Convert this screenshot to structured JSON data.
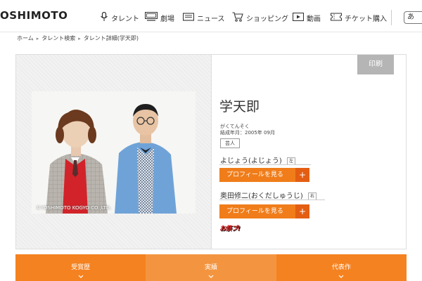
{
  "header": {
    "logo": "OSHIMOTO",
    "nav": [
      {
        "label": "タレント",
        "icon": "microphone-icon"
      },
      {
        "label": "劇場",
        "icon": "theater-icon"
      },
      {
        "label": "ニュース",
        "icon": "news-icon"
      },
      {
        "label": "ショッピング",
        "icon": "cart-icon"
      },
      {
        "label": "動画",
        "icon": "video-icon"
      },
      {
        "label": "チケット購入",
        "icon": "ticket-icon"
      }
    ],
    "lang_label": "あ"
  },
  "breadcrumb": [
    "ホーム",
    "タレント検索",
    "タレント詳細(学天即)"
  ],
  "talent": {
    "photo_copyright": "©YOSHIMOTO KOGYO CO.,LTD.",
    "print_label": "印刷",
    "name": "学天即",
    "kana": "がくてんそく",
    "formed": "結成年月：2005年 09月",
    "tag": "芸人",
    "members": [
      {
        "name": "よじょう(よじょう)",
        "side": "左",
        "button": "プロフィールを見る",
        "plus": "+"
      },
      {
        "name": "奥田修二(おくだしゅうじ)",
        "side": "右",
        "button": "プロフィールを見る",
        "plus": "+"
      }
    ],
    "stamp_text": "お祭ブ!"
  },
  "tabs": [
    {
      "label": "受賞歴"
    },
    {
      "label": "実績"
    },
    {
      "label": "代表作"
    }
  ],
  "colors": {
    "accent": "#f58220",
    "accent_dark": "#e35e12",
    "print_button": "#b5b5b5"
  }
}
